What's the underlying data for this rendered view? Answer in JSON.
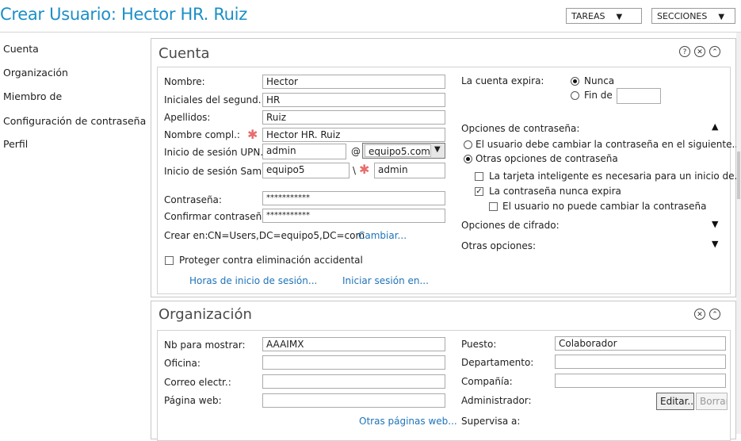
{
  "window": {
    "title": "Crear Usuario: Hector HR. Ruiz"
  },
  "toolbar": {
    "tareas": "TAREAS",
    "secciones": "SECCIONES",
    "arrow": "▼"
  },
  "nav": [
    "Cuenta",
    "Organización",
    "Miembro de",
    "Configuración de contraseña",
    "Perfil"
  ],
  "cuenta": {
    "header": "Cuenta",
    "icons": {
      "help": "?",
      "close": "✕",
      "collapse": "⌃"
    },
    "labels": {
      "nombre": "Nombre:",
      "iniciales": "Iniciales del segund...",
      "apellidos": "Apellidos:",
      "nombre_compl": "Nombre compl.:",
      "upn": "Inicio de sesión UPN...",
      "sam": "Inicio de sesión Sam...",
      "contrasena": "Contraseña:",
      "confirmar": "Confirmar contraseña:",
      "crear_en": "Crear en:"
    },
    "values": {
      "nombre": "Hector",
      "iniciales": "HR",
      "apellidos": "Ruiz",
      "nombre_compl": "Hector HR. Ruiz",
      "upn_user": "admin",
      "upn_at": "@",
      "upn_domain": "equipo5.com",
      "sam_domain": "equipo5",
      "sam_sep": "\\",
      "sam_user": "admin",
      "contrasena": "***********",
      "confirmar": "***********",
      "crear_en": "CN=Users,DC=equipo5,DC=com"
    },
    "cambiar": "Cambiar...",
    "proteger": "Proteger contra eliminación accidental",
    "horas": "Horas de inicio de sesión...",
    "iniciar": "Iniciar sesión en...",
    "expira_label": "La cuenta expira:",
    "nunca": "Nunca",
    "fin_de": "Fin de",
    "opc_contra": "Opciones de contraseña:",
    "opt_cambiar": "El usuario debe cambiar la contraseña en el siguiente...",
    "opt_otras": "Otras opciones de contraseña",
    "chk_tarjeta": "La tarjeta inteligente es necesaria para un inicio de...",
    "chk_nunca": "La contraseña nunca expira",
    "chk_no_cambiar": "El usuario no puede cambiar la contraseña",
    "opc_cifrado": "Opciones de cifrado:",
    "otras_opc": "Otras opciones:",
    "required": "✱"
  },
  "org": {
    "header": "Organización",
    "labels": {
      "nb": "Nb para mostrar:",
      "oficina": "Oficina:",
      "correo": "Correo electr.:",
      "pagina": "Página web:",
      "puesto": "Puesto:",
      "depto": "Departamento:",
      "compania": "Compañía:",
      "admin": "Administrador:",
      "supervisa": "Supervisa a:"
    },
    "values": {
      "nb": "AAAIMX",
      "puesto": "Colaborador"
    },
    "otras_paginas": "Otras páginas web...",
    "editar": "Editar...",
    "borrar": "Borrar"
  }
}
